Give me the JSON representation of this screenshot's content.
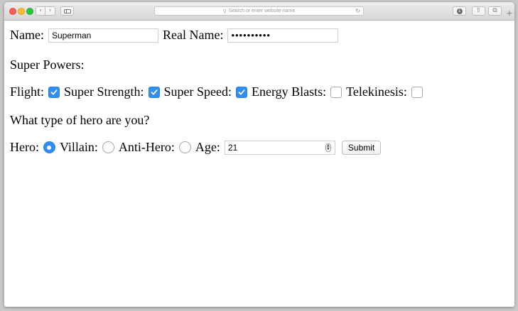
{
  "browser": {
    "nav_back_icon": "chevron-left",
    "nav_forward_icon": "chevron-right",
    "url_placeholder": "Search or enter website name"
  },
  "form": {
    "name_label": "Name:",
    "name_value": "Superman",
    "real_name_label": "Real Name:",
    "real_name_value": "••••••••••",
    "super_powers_heading": "Super Powers:",
    "powers": [
      {
        "label": "Flight:",
        "checked": true
      },
      {
        "label": "Super Strength:",
        "checked": true
      },
      {
        "label": "Super Speed:",
        "checked": true
      },
      {
        "label": "Energy Blasts:",
        "checked": false
      },
      {
        "label": "Telekinesis:",
        "checked": false
      }
    ],
    "hero_type_question": "What type of hero are you?",
    "hero_types": [
      {
        "label": "Hero:",
        "selected": true
      },
      {
        "label": "Villain:",
        "selected": false
      },
      {
        "label": "Anti-Hero:",
        "selected": false
      }
    ],
    "age_label": "Age:",
    "age_value": "21",
    "submit_label": "Submit"
  },
  "colors": {
    "accent": "#2f8ef0",
    "close": "#fc5f57",
    "minimize": "#fdbc2e",
    "maximize": "#29c840"
  }
}
